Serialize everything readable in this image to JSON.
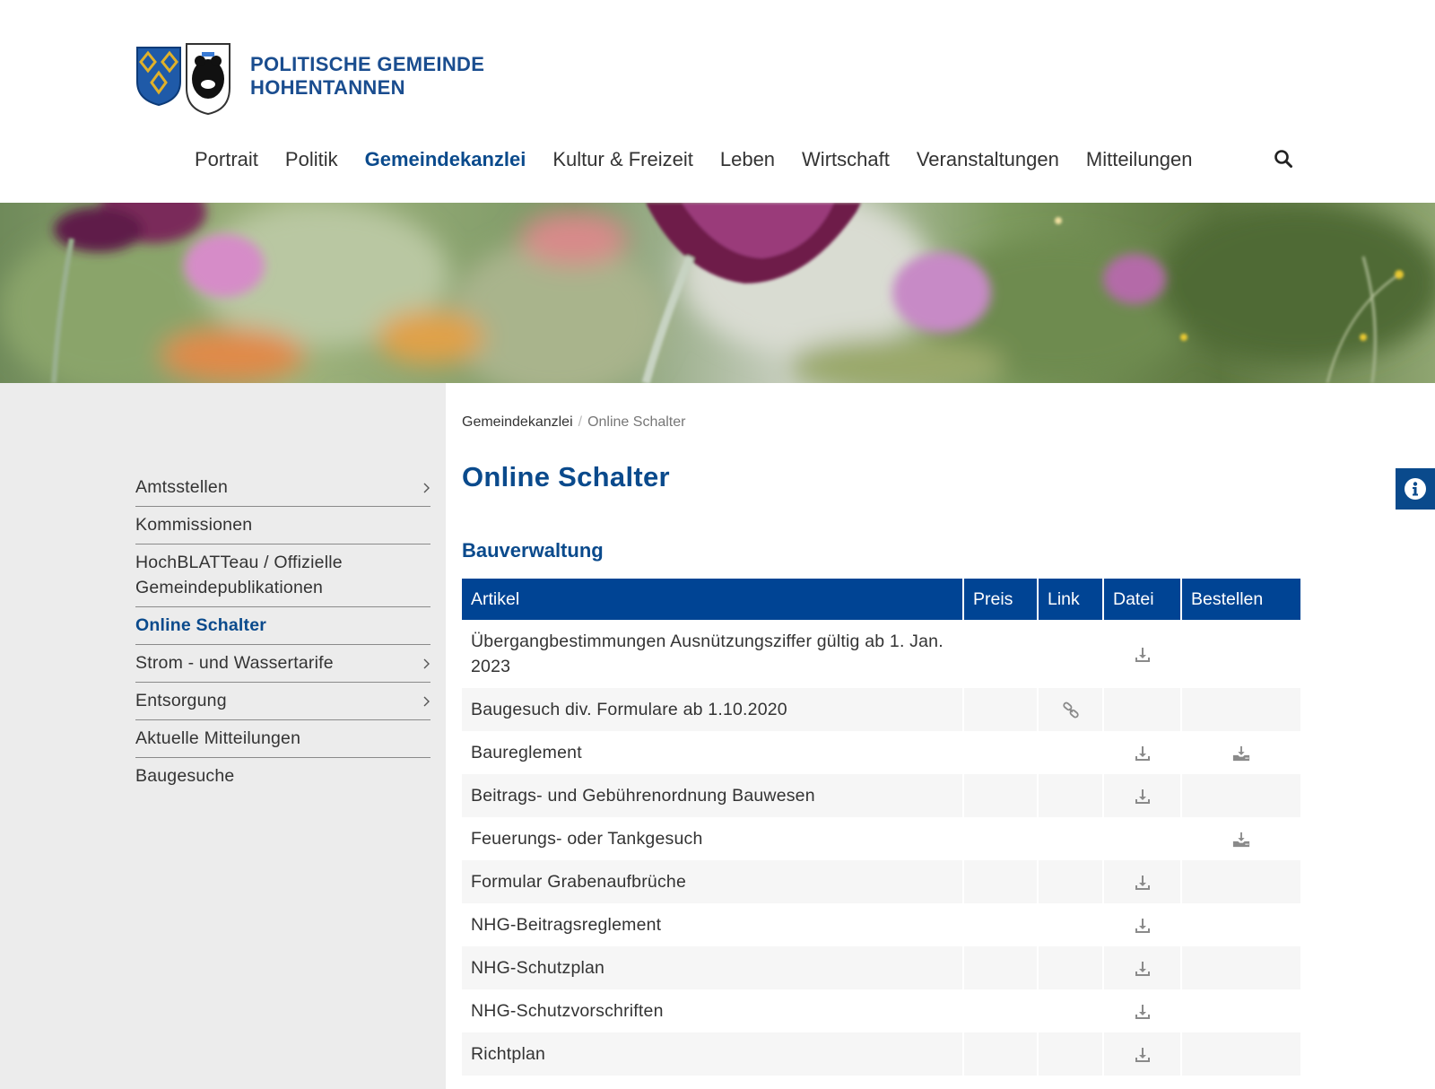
{
  "header": {
    "logo_line1": "POLITISCHE GEMEINDE",
    "logo_line2": "HOHENTANNEN",
    "nav": [
      {
        "label": "Portrait"
      },
      {
        "label": "Politik"
      },
      {
        "label": "Gemeindekanzlei"
      },
      {
        "label": "Kultur & Freizeit"
      },
      {
        "label": "Leben"
      },
      {
        "label": "Wirtschaft"
      },
      {
        "label": "Veranstaltungen"
      },
      {
        "label": "Mitteilungen"
      }
    ],
    "active_nav": "Gemeindekanzlei"
  },
  "sidebar": {
    "items": [
      {
        "label": "Amtsstellen",
        "has_children": true
      },
      {
        "label": "Kommissionen",
        "has_children": false
      },
      {
        "label": "HochBLATTeau / Offizielle Gemeindepublikationen",
        "has_children": false
      },
      {
        "label": "Online Schalter",
        "has_children": false,
        "active": true
      },
      {
        "label": "Strom - und Wassertarife",
        "has_children": true
      },
      {
        "label": "Entsorgung",
        "has_children": true
      },
      {
        "label": "Aktuelle Mitteilungen",
        "has_children": false
      },
      {
        "label": "Baugesuche",
        "has_children": false
      }
    ]
  },
  "breadcrumb": {
    "parent": "Gemeindekanzlei",
    "separator": "/",
    "current": "Online Schalter"
  },
  "main": {
    "title": "Online Schalter",
    "section_title": "Bauverwaltung",
    "table": {
      "headers": {
        "artikel": "Artikel",
        "preis": "Preis",
        "link": "Link",
        "datei": "Datei",
        "bestellen": "Bestellen"
      },
      "rows": [
        {
          "artikel": "Übergangbestimmungen Ausnützungsziffer gültig ab 1. Jan. 2023",
          "link": false,
          "datei": true,
          "bestellen": false
        },
        {
          "artikel": "Baugesuch div. Formulare ab 1.10.2020",
          "link": true,
          "datei": false,
          "bestellen": false
        },
        {
          "artikel": "Baureglement",
          "link": false,
          "datei": true,
          "bestellen": true
        },
        {
          "artikel": "Beitrags- und Gebührenordnung Bauwesen",
          "link": false,
          "datei": true,
          "bestellen": false
        },
        {
          "artikel": "Feuerungs- oder Tankgesuch",
          "link": false,
          "datei": false,
          "bestellen": true
        },
        {
          "artikel": "Formular Grabenaufbrüche",
          "link": false,
          "datei": true,
          "bestellen": false
        },
        {
          "artikel": "NHG-Beitragsreglement",
          "link": false,
          "datei": true,
          "bestellen": false
        },
        {
          "artikel": "NHG-Schutzplan",
          "link": false,
          "datei": true,
          "bestellen": false
        },
        {
          "artikel": "NHG-Schutzvorschriften",
          "link": false,
          "datei": true,
          "bestellen": false
        },
        {
          "artikel": "Richtplan",
          "link": false,
          "datei": true,
          "bestellen": false
        }
      ]
    }
  },
  "colors": {
    "brand_blue": "#0a4a8c",
    "table_header": "#004494",
    "sidebar_bg": "#ececec"
  },
  "icons": {
    "search": "search-icon",
    "download": "download-icon",
    "order": "order-download-icon",
    "link": "link-icon",
    "info": "info-icon",
    "chevron": "chevron-right-icon"
  }
}
